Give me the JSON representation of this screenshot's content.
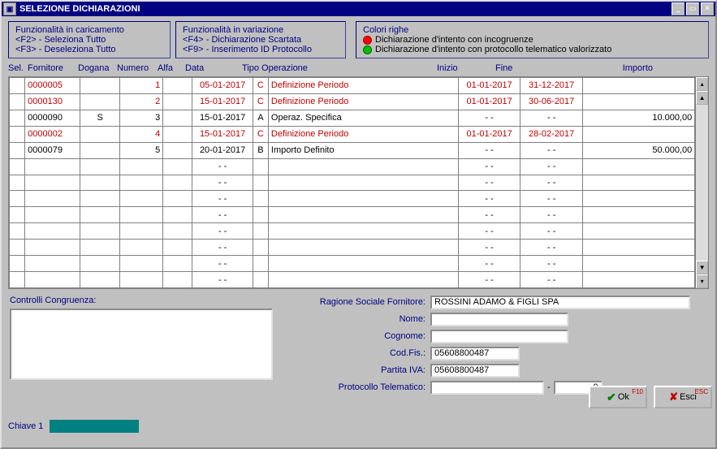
{
  "window": {
    "title": "SELEZIONE DICHIARAZIONI"
  },
  "box1": {
    "title": "Funzionalità in caricamento",
    "line1": "<F2> - Seleziona Tutto",
    "line2": "<F3> - Deseleziona Tutto"
  },
  "box2": {
    "title": "Funzionalità in variazione",
    "line1": "<F4> - Dichiarazione Scartata",
    "line2": "<F9> - Inserimento ID Protocollo"
  },
  "box3": {
    "title": "Colori righe",
    "line1": "Dichiarazione d'intento con incogruenze",
    "line2": "Dichiarazione d'intento con protocollo telematico valorizzato"
  },
  "headers": {
    "sel": "Sel.",
    "fornitore": "Fornitore",
    "dogana": "Dogana",
    "numero": "Numero",
    "alfa": "Alfa",
    "data": "Data",
    "tipo": "Tipo Operazione",
    "inizio": "Inizio",
    "fine": "Fine",
    "importo": "Importo"
  },
  "rows": [
    {
      "red": true,
      "fornitore": "0000005",
      "dogana": "",
      "numero": "1",
      "alfa": "",
      "data": "05-01-2017",
      "tipo_c": "C",
      "tipo_t": "Definizione Periodo",
      "inizio": "01-01-2017",
      "fine": "31-12-2017",
      "importo": ""
    },
    {
      "red": true,
      "fornitore": "0000130",
      "dogana": "",
      "numero": "2",
      "alfa": "",
      "data": "15-01-2017",
      "tipo_c": "C",
      "tipo_t": "Definizione Periodo",
      "inizio": "01-01-2017",
      "fine": "30-06-2017",
      "importo": ""
    },
    {
      "red": false,
      "fornitore": "0000090",
      "dogana": "S",
      "numero": "3",
      "alfa": "",
      "data": "15-01-2017",
      "tipo_c": "A",
      "tipo_t": "Operaz. Specifica",
      "inizio": "- -",
      "fine": "- -",
      "importo": "10.000,00"
    },
    {
      "red": true,
      "fornitore": "0000002",
      "dogana": "",
      "numero": "4",
      "alfa": "",
      "data": "15-01-2017",
      "tipo_c": "C",
      "tipo_t": "Definizione Periodo",
      "inizio": "01-01-2017",
      "fine": "28-02-2017",
      "importo": ""
    },
    {
      "red": false,
      "dotted": true,
      "fornitore": "0000079",
      "dogana": "",
      "numero": "5",
      "alfa": "",
      "data": "20-01-2017",
      "tipo_c": "B",
      "tipo_t": "Importo Definito",
      "inizio": "- -",
      "fine": "- -",
      "importo": "50.000,00"
    },
    {
      "blank": true,
      "data": "- -",
      "inizio": "- -",
      "fine": "- -"
    },
    {
      "blank": true,
      "data": "- -",
      "inizio": "- -",
      "fine": "- -"
    },
    {
      "blank": true,
      "data": "- -",
      "inizio": "- -",
      "fine": "- -"
    },
    {
      "blank": true,
      "data": "- -",
      "inizio": "- -",
      "fine": "- -"
    },
    {
      "blank": true,
      "data": "- -",
      "inizio": "- -",
      "fine": "- -"
    },
    {
      "blank": true,
      "data": "- -",
      "inizio": "- -",
      "fine": "- -"
    },
    {
      "blank": true,
      "data": "- -",
      "inizio": "- -",
      "fine": "- -"
    },
    {
      "blank": true,
      "data": "- -",
      "inizio": "- -",
      "fine": "- -"
    }
  ],
  "labels": {
    "controlli": "Controlli Congruenza:",
    "ragione": "Ragione Sociale Fornitore:",
    "nome": "Nome:",
    "cognome": "Cognome:",
    "codfis": "Cod.Fis.:",
    "piva": "Partita IVA:",
    "protocollo": "Protocollo Telematico:",
    "dash": "-",
    "ok": "Ok",
    "ok_fkey": "F10",
    "esci": "Esci",
    "esci_fkey": "ESC",
    "chiave": "Chiave 1"
  },
  "fields": {
    "ragione": "ROSSINI ADAMO & FIGLI SPA",
    "nome": "",
    "cognome": "",
    "codfis": "05608800487",
    "piva": "05608800487",
    "proto1": "",
    "proto2": "0"
  }
}
